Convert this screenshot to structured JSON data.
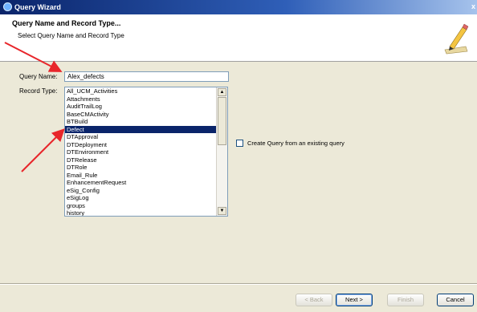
{
  "window": {
    "title": "Query Wizard",
    "close_glyph": "x"
  },
  "header": {
    "title": "Query Name and Record Type...",
    "subtitle": "Select Query Name and Record Type",
    "icon": "wizard-pencil-icon"
  },
  "form": {
    "query_name_label": "Query Name:",
    "query_name_value": "Alex_defects",
    "record_type_label": "Record Type:",
    "record_types": [
      "All_UCM_Activities",
      "Attachments",
      "AuditTrailLog",
      "BaseCMActivity",
      "BTBuild",
      "Defect",
      "DTApproval",
      "DTDeployment",
      "DTEnvironment",
      "DTRelease",
      "DTRole",
      "Email_Rule",
      "EnhancementRequest",
      "eSig_Config",
      "eSigLog",
      "groups",
      "history"
    ],
    "selected_record_type": "Defect",
    "create_from_existing_label": "Create Query from an existing query",
    "create_from_existing_checked": false
  },
  "buttons": {
    "back": "< Back",
    "next": "Next >",
    "finish": "Finish",
    "cancel": "Cancel"
  },
  "annotation_color": "#e8262b"
}
